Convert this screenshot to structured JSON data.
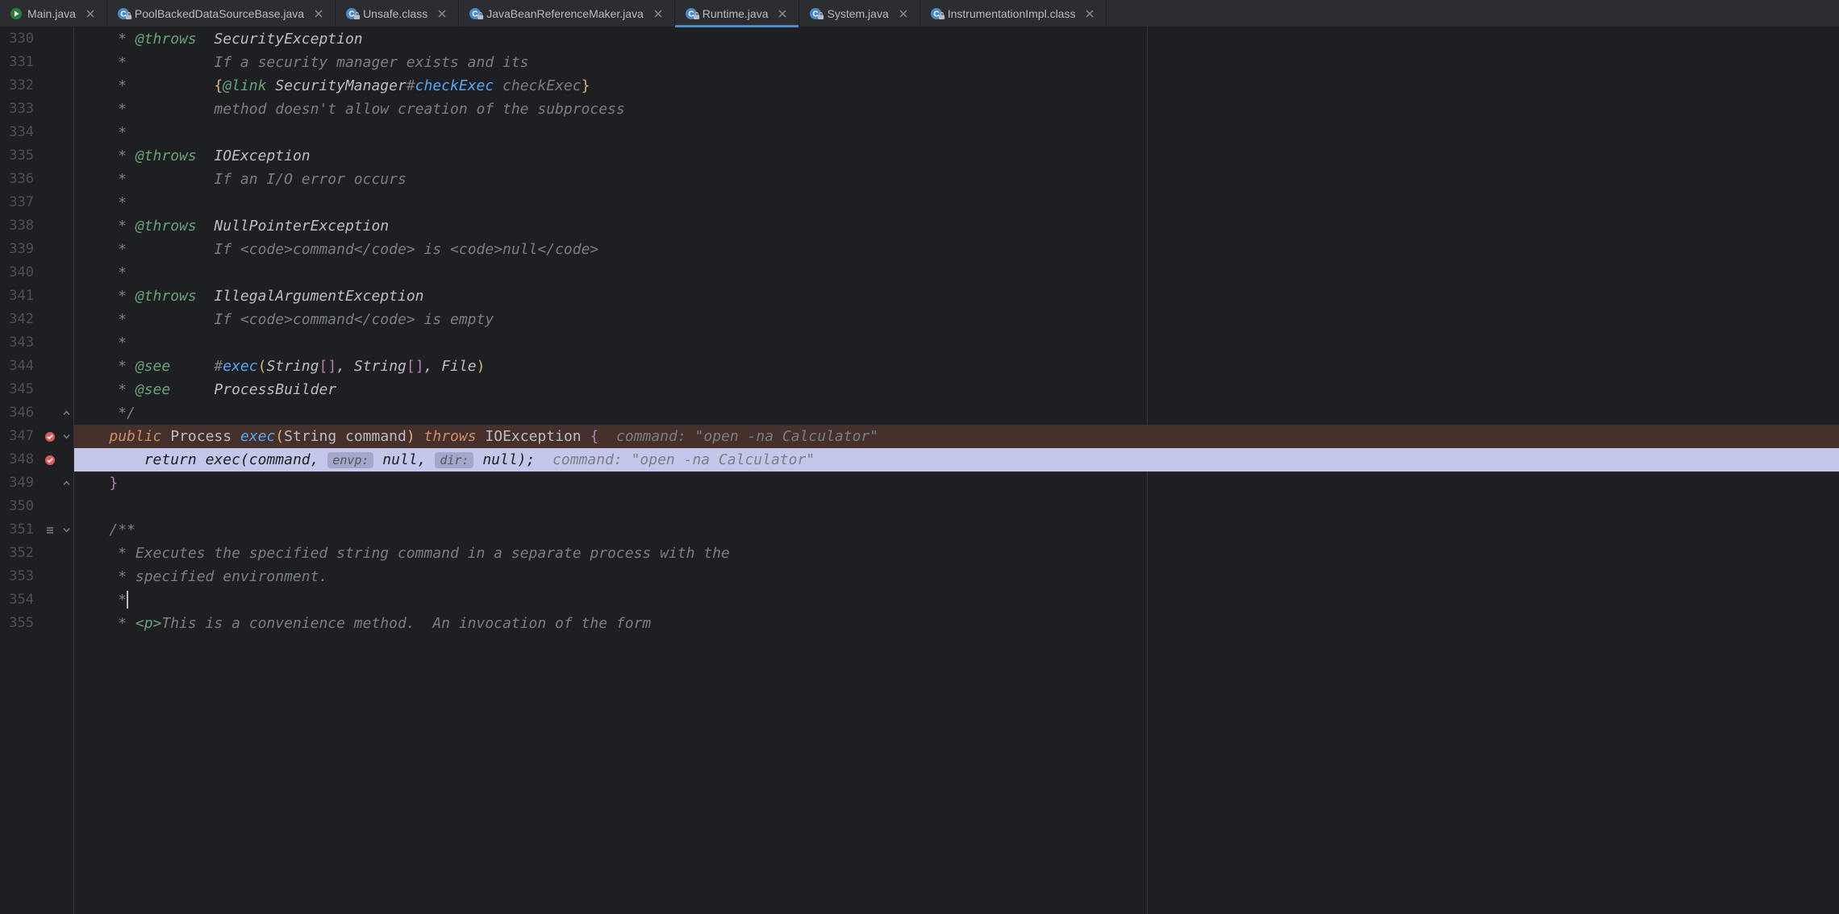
{
  "tabs": [
    {
      "label": "Main.java",
      "icon": "run-class",
      "locked": false,
      "active": false
    },
    {
      "label": "PoolBackedDataSourceBase.java",
      "icon": "class-locked",
      "locked": true,
      "active": false
    },
    {
      "label": "Unsafe.class",
      "icon": "class-locked",
      "locked": true,
      "active": false
    },
    {
      "label": "JavaBeanReferenceMaker.java",
      "icon": "class-locked",
      "locked": true,
      "active": false
    },
    {
      "label": "Runtime.java",
      "icon": "class-locked",
      "locked": true,
      "active": true
    },
    {
      "label": "System.java",
      "icon": "class-locked",
      "locked": true,
      "active": false
    },
    {
      "label": "InstrumentationImpl.class",
      "icon": "class-locked",
      "locked": true,
      "active": false
    }
  ],
  "startLine": 330,
  "lines": [
    {
      "n": 330,
      "frags": [
        {
          "t": "     * ",
          "c": "c-comment"
        },
        {
          "t": "@throws",
          "c": "c-doctag"
        },
        {
          "t": "  ",
          "c": "c-comment"
        },
        {
          "t": "SecurityException",
          "c": "c-type"
        }
      ]
    },
    {
      "n": 331,
      "frags": [
        {
          "t": "     *          ",
          "c": "c-comment"
        },
        {
          "t": "If a security manager exists and its",
          "c": "c-comment"
        }
      ]
    },
    {
      "n": 332,
      "frags": [
        {
          "t": "     *          ",
          "c": "c-comment"
        },
        {
          "t": "{",
          "c": "c-brace-y"
        },
        {
          "t": "@link",
          "c": "c-link"
        },
        {
          "t": " ",
          "c": "c-comment"
        },
        {
          "t": "SecurityManager",
          "c": "c-type"
        },
        {
          "t": "#",
          "c": "c-hash"
        },
        {
          "t": "checkExec",
          "c": "c-linkref"
        },
        {
          "t": " checkExec",
          "c": "c-linktxt"
        },
        {
          "t": "}",
          "c": "c-brace-y"
        }
      ]
    },
    {
      "n": 333,
      "frags": [
        {
          "t": "     *          ",
          "c": "c-comment"
        },
        {
          "t": "method doesn't allow creation of the subprocess",
          "c": "c-comment"
        }
      ]
    },
    {
      "n": 334,
      "frags": [
        {
          "t": "     *",
          "c": "c-comment"
        }
      ]
    },
    {
      "n": 335,
      "frags": [
        {
          "t": "     * ",
          "c": "c-comment"
        },
        {
          "t": "@throws",
          "c": "c-doctag"
        },
        {
          "t": "  ",
          "c": "c-comment"
        },
        {
          "t": "IOException",
          "c": "c-type"
        }
      ]
    },
    {
      "n": 336,
      "frags": [
        {
          "t": "     *          ",
          "c": "c-comment"
        },
        {
          "t": "If an I/O error occurs",
          "c": "c-comment"
        }
      ]
    },
    {
      "n": 337,
      "frags": [
        {
          "t": "     *",
          "c": "c-comment"
        }
      ]
    },
    {
      "n": 338,
      "frags": [
        {
          "t": "     * ",
          "c": "c-comment"
        },
        {
          "t": "@throws",
          "c": "c-doctag"
        },
        {
          "t": "  ",
          "c": "c-comment"
        },
        {
          "t": "NullPointerException",
          "c": "c-type"
        }
      ]
    },
    {
      "n": 339,
      "frags": [
        {
          "t": "     *          ",
          "c": "c-comment"
        },
        {
          "t": "If ",
          "c": "c-comment"
        },
        {
          "t": "<code>",
          "c": "c-tag"
        },
        {
          "t": "command",
          "c": "c-comment"
        },
        {
          "t": "</code>",
          "c": "c-tag"
        },
        {
          "t": " is ",
          "c": "c-comment"
        },
        {
          "t": "<code>",
          "c": "c-tag"
        },
        {
          "t": "null",
          "c": "c-comment"
        },
        {
          "t": "</code>",
          "c": "c-tag"
        }
      ]
    },
    {
      "n": 340,
      "frags": [
        {
          "t": "     *",
          "c": "c-comment"
        }
      ]
    },
    {
      "n": 341,
      "frags": [
        {
          "t": "     * ",
          "c": "c-comment"
        },
        {
          "t": "@throws",
          "c": "c-doctag"
        },
        {
          "t": "  ",
          "c": "c-comment"
        },
        {
          "t": "IllegalArgumentException",
          "c": "c-type"
        }
      ]
    },
    {
      "n": 342,
      "frags": [
        {
          "t": "     *          ",
          "c": "c-comment"
        },
        {
          "t": "If ",
          "c": "c-comment"
        },
        {
          "t": "<code>",
          "c": "c-tag"
        },
        {
          "t": "command",
          "c": "c-comment"
        },
        {
          "t": "</code>",
          "c": "c-tag"
        },
        {
          "t": " is empty",
          "c": "c-comment"
        }
      ]
    },
    {
      "n": 343,
      "frags": [
        {
          "t": "     *",
          "c": "c-comment"
        }
      ]
    },
    {
      "n": 344,
      "frags": [
        {
          "t": "     * ",
          "c": "c-comment"
        },
        {
          "t": "@see",
          "c": "c-doctag"
        },
        {
          "t": "     ",
          "c": "c-comment"
        },
        {
          "t": "#",
          "c": "c-hash"
        },
        {
          "t": "exec",
          "c": "c-linkref"
        },
        {
          "t": "(",
          "c": "c-brace-y"
        },
        {
          "t": "String",
          "c": "c-type"
        },
        {
          "t": "[]",
          "c": "c-brace-p"
        },
        {
          "t": ", ",
          "c": "c-type"
        },
        {
          "t": "String",
          "c": "c-type"
        },
        {
          "t": "[]",
          "c": "c-brace-p"
        },
        {
          "t": ", ",
          "c": "c-type"
        },
        {
          "t": "File",
          "c": "c-type"
        },
        {
          "t": ")",
          "c": "c-brace-y"
        }
      ]
    },
    {
      "n": 345,
      "frags": [
        {
          "t": "     * ",
          "c": "c-comment"
        },
        {
          "t": "@see",
          "c": "c-doctag"
        },
        {
          "t": "     ",
          "c": "c-comment"
        },
        {
          "t": "ProcessBuilder",
          "c": "c-type"
        }
      ]
    },
    {
      "n": 346,
      "frags": [
        {
          "t": "     */",
          "c": "c-comment"
        }
      ],
      "foldEnd": true
    },
    {
      "n": 347,
      "hl": "hl-red",
      "bp": true,
      "foldStart": true,
      "frags": [
        {
          "t": "    ",
          "c": "c-default"
        },
        {
          "t": "public",
          "c": "c-kw-it"
        },
        {
          "t": " Process ",
          "c": "c-default"
        },
        {
          "t": "exec",
          "c": "c-fn"
        },
        {
          "t": "(",
          "c": "c-brace-y"
        },
        {
          "t": "String ",
          "c": "c-default"
        },
        {
          "t": "command",
          "c": "c-param"
        },
        {
          "t": ")",
          "c": "c-brace-y"
        },
        {
          "t": " ",
          "c": "c-default"
        },
        {
          "t": "throws",
          "c": "c-kw-it"
        },
        {
          "t": " IOException ",
          "c": "c-default"
        },
        {
          "t": "{",
          "c": "c-brace-p"
        },
        {
          "t": "  ",
          "c": "c-default"
        },
        {
          "t": "command: \"open -na Calculator\"",
          "c": "c-hint"
        }
      ]
    },
    {
      "n": 348,
      "hl": "hl-blue",
      "bp": true,
      "frags": [
        {
          "t": "        ",
          "c": "c-default"
        },
        {
          "t": "return",
          "c": "c-kw"
        },
        {
          "t": " exec(command, ",
          "c": "c-default"
        },
        {
          "t": "envp:",
          "c": "c-hint-lbl"
        },
        {
          "t": " ",
          "c": "c-default"
        },
        {
          "t": "null",
          "c": "c-hint-val"
        },
        {
          "t": ", ",
          "c": "c-default"
        },
        {
          "t": "dir:",
          "c": "c-hint-lbl"
        },
        {
          "t": " ",
          "c": "c-default"
        },
        {
          "t": "null",
          "c": "c-hint-val"
        },
        {
          "t": ");  ",
          "c": "c-default"
        },
        {
          "t": "command: \"open -na Calculator\"",
          "c": "c-hint"
        }
      ]
    },
    {
      "n": 349,
      "foldEnd": true,
      "frags": [
        {
          "t": "    ",
          "c": "c-default"
        },
        {
          "t": "}",
          "c": "c-brace-p"
        }
      ]
    },
    {
      "n": 350,
      "frags": []
    },
    {
      "n": 351,
      "foldStart": true,
      "indent": true,
      "frags": [
        {
          "t": "    ",
          "c": "c-default"
        },
        {
          "t": "/**",
          "c": "c-comment"
        }
      ]
    },
    {
      "n": 352,
      "frags": [
        {
          "t": "     * ",
          "c": "c-comment"
        },
        {
          "t": "Executes the specified string command in a separate process with the",
          "c": "c-comment"
        }
      ]
    },
    {
      "n": 353,
      "frags": [
        {
          "t": "     * ",
          "c": "c-comment"
        },
        {
          "t": "specified environment.",
          "c": "c-comment"
        }
      ]
    },
    {
      "n": 354,
      "cursor": true,
      "frags": [
        {
          "t": "     *",
          "c": "c-comment"
        }
      ]
    },
    {
      "n": 355,
      "frags": [
        {
          "t": "     * ",
          "c": "c-comment"
        },
        {
          "t": "<p>",
          "c": "c-doctag"
        },
        {
          "t": "This is a convenience method.  An invocation of the form",
          "c": "c-comment"
        }
      ]
    }
  ]
}
